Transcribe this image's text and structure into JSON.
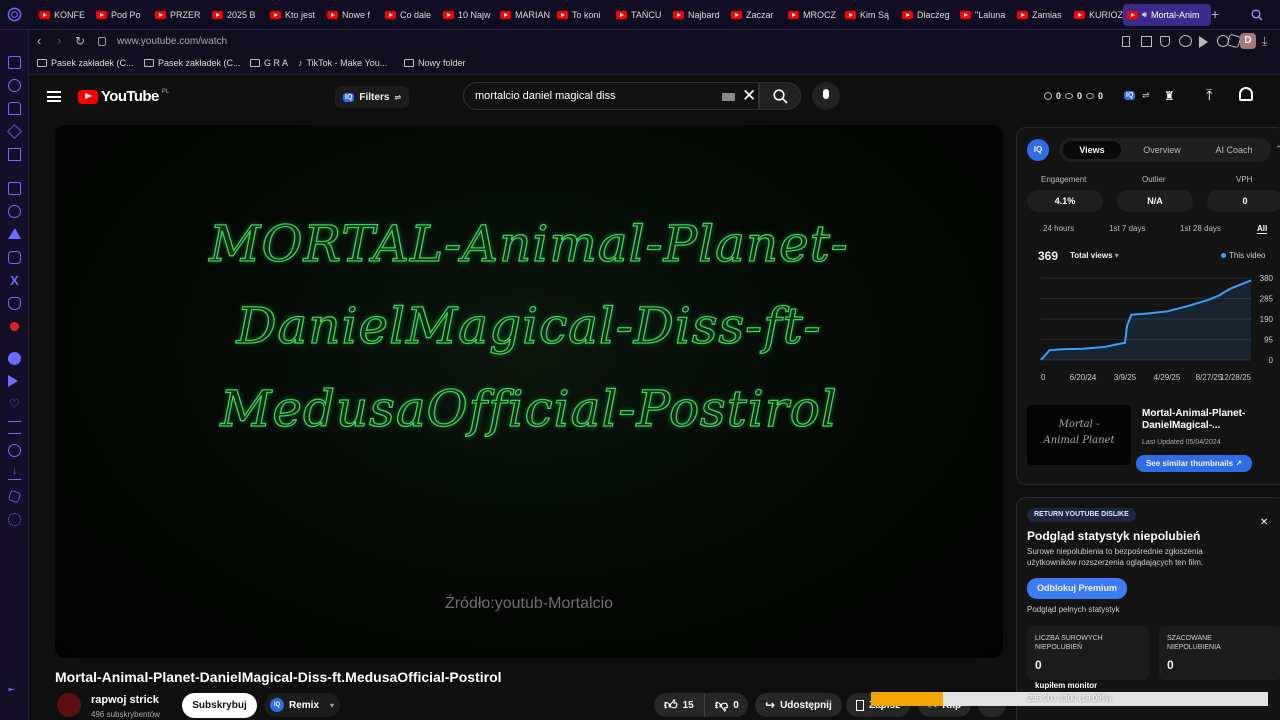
{
  "tabs": [
    {
      "label": "KONFE"
    },
    {
      "label": "Pod Po"
    },
    {
      "label": "PRZER"
    },
    {
      "label": "2025 B"
    },
    {
      "label": "Kto jest"
    },
    {
      "label": "Nowe f"
    },
    {
      "label": "Co dale"
    },
    {
      "label": "10 Najw"
    },
    {
      "label": "MARIAN"
    },
    {
      "label": "To koni"
    },
    {
      "label": "TAŃCU"
    },
    {
      "label": "Najbard"
    },
    {
      "label": "Zaczar"
    },
    {
      "label": "MROCZ"
    },
    {
      "label": "Kim Są"
    },
    {
      "label": "Dlaczeg"
    },
    {
      "label": "\"Laluna"
    },
    {
      "label": "Zamias"
    },
    {
      "label": "KURIOZ"
    }
  ],
  "active_tab": {
    "label": "Mortal-Anim"
  },
  "address": {
    "url": "www.youtube.com/watch"
  },
  "bookmarks": [
    {
      "label": "Pasek zakładek (C..."
    },
    {
      "label": "Pasek zakładek (C..."
    },
    {
      "label": "G R A"
    },
    {
      "label": "TikTok - Make You..."
    },
    {
      "label": "Nowy folder"
    }
  ],
  "profile": {
    "initial": "D"
  },
  "youtube": {
    "logo_text": "YouTube",
    "region": "PL",
    "filters_label": "Filters",
    "vidiq_badge": "IQ",
    "search_value": "mortalcio daniel magical diss",
    "counters": {
      "a": "0",
      "b": "0",
      "c": "0"
    }
  },
  "video": {
    "overlay_lines": [
      "MORTAL-Animal-Planet-",
      "DanielMagical-Diss-ft-",
      "MedusaOfficial-Postirol"
    ],
    "watermark": "Źródło:youtub-Mortalcio",
    "title": "Mortal-Animal-Planet-DanielMagical-Diss-ft.MedusaOfficial-Postirol",
    "channel": "rapwoj strick",
    "subscribers": "496 subskrybentów",
    "subscribe_label": "Subskrybuj",
    "remix_label": "Remix",
    "likes": "15",
    "dislikes": "0",
    "share_label": "Udostępnij",
    "save_label": "Zapisz",
    "clip_label": "Klip"
  },
  "vidiq": {
    "tabs": [
      "Views",
      "Overview",
      "AI Coach"
    ],
    "active_tab": "Views",
    "metrics": [
      {
        "label": "Engagement",
        "value": "4.1%"
      },
      {
        "label": "Outlier",
        "value": "N/A"
      },
      {
        "label": "VPH",
        "value": "0"
      }
    ],
    "ranges": [
      "24 hours",
      "1st 7 days",
      "1st 28 days",
      "All"
    ],
    "active_range": "All",
    "total": "369",
    "total_label": "Total views",
    "legend": "This video",
    "thumb_text": [
      "Mortal -",
      "Animal Planet"
    ],
    "card_title": "Mortal-Animal-Planet-DanielMagical-...",
    "card_date": "Last Updated 05/04/2024",
    "card_button": "See similar thumbnails"
  },
  "chart_data": {
    "type": "line",
    "x_ticks": [
      "0",
      "6/20/24",
      "3/9/25",
      "4/29/25",
      "8/27/25",
      "12/28/25"
    ],
    "y_ticks": [
      "0",
      "95",
      "190",
      "285",
      "380"
    ],
    "ylim": [
      0,
      380
    ],
    "series": [
      {
        "name": "This video",
        "x": [
          0,
          0.04,
          0.1,
          0.2,
          0.3,
          0.35,
          0.4,
          0.41,
          0.43,
          0.5,
          0.6,
          0.7,
          0.8,
          0.85,
          0.9,
          1.0
        ],
        "values": [
          0,
          45,
          50,
          52,
          60,
          70,
          80,
          160,
          210,
          215,
          225,
          250,
          280,
          300,
          330,
          369
        ]
      }
    ]
  },
  "ryd": {
    "badge": "RETURN YOUTUBE DISLIKE",
    "heading": "Podgląd statystyk niepolubień",
    "desc": "Surowe niepolubienia to bezpośrednie zgłoszenia użytkowników rozszerzenia oglądających ten film.",
    "button": "Odblokuj Premium",
    "sub": "Podgląd pełnych statystyk",
    "box1_label": "LICZBA SUROWYCH NIEPOLUBIEŃ",
    "box1_value": "0",
    "box2_label": "SZACOWANE NIEPOLUBIENIA",
    "box2_value": "0"
  },
  "overlay": {
    "monitor_label": "kupiłem monitor",
    "progress_text": "235.00 / 1300 (18.08%)",
    "progress_fraction": 0.1808
  }
}
